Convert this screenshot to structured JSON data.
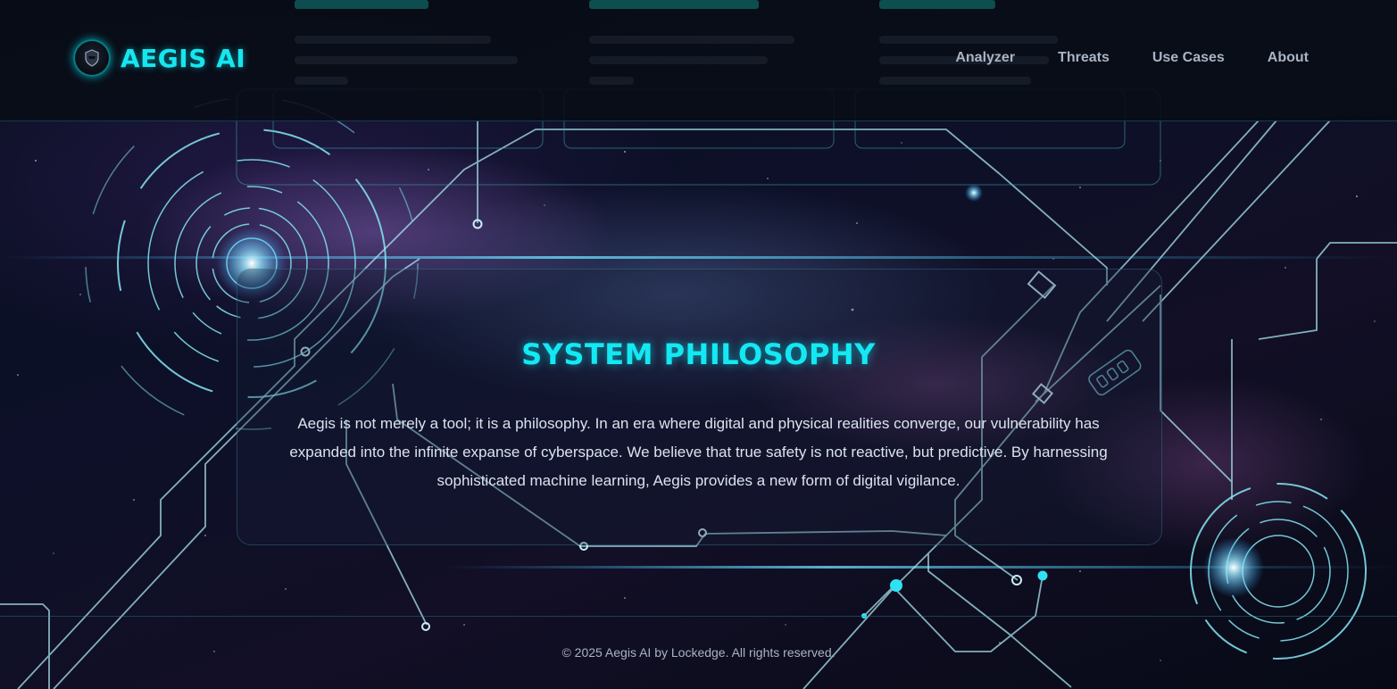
{
  "header": {
    "brand": "AEGIS AI",
    "logo_icon": "shield-helmet-icon",
    "nav": [
      {
        "label": "Analyzer"
      },
      {
        "label": "Threats"
      },
      {
        "label": "Use Cases"
      },
      {
        "label": "About"
      }
    ]
  },
  "philosophy": {
    "title": "SYSTEM PHILOSOPHY",
    "body": "Aegis is not merely a tool; it is a philosophy. In an era where digital and physical realities converge, our vulnerability has expanded into the infinite expanse of cyberspace. We believe that true safety is not reactive, but predictive. By harnessing sophisticated machine learning, Aegis provides a new form of digital vigilance."
  },
  "footer": {
    "copyright": "© 2025 Aegis AI by Lockedge. All rights reserved."
  },
  "colors": {
    "accent": "#16e6f0",
    "background": "#070a16",
    "circuit": "#7fd8e8"
  }
}
